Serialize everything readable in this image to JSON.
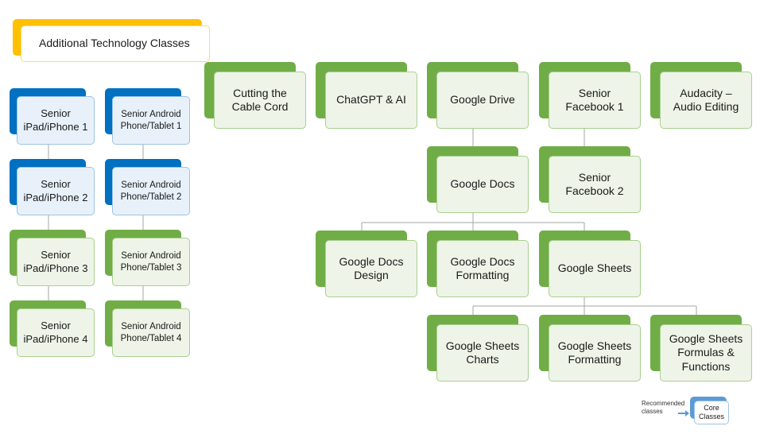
{
  "title": "Additional Technology Classes",
  "colors": {
    "core": "#70ad47",
    "recommended": "#0070c0",
    "title_accent": "#ffc000",
    "connector": "#a6a6a6"
  },
  "nodes": {
    "ipad1": "Senior\niPad/iPhone 1",
    "ipad2": "Senior\niPad/iPhone 2",
    "ipad3": "Senior\niPad/iPhone 3",
    "ipad4": "Senior\niPad/iPhone 4",
    "android1": "Senior Android\nPhone/Tablet 1",
    "android2": "Senior Android\nPhone/Tablet 2",
    "android3": "Senior Android\nPhone/Tablet 3",
    "android4": "Senior Android\nPhone/Tablet 4",
    "cable": "Cutting the\nCable Cord",
    "chatgpt": "ChatGPT & AI",
    "drive": "Google Drive",
    "facebook1": "Senior\nFacebook 1",
    "audacity": "Audacity –\nAudio Editing",
    "docs": "Google Docs",
    "facebook2": "Senior\nFacebook 2",
    "docs_design": "Google Docs\nDesign",
    "docs_formatting": "Google Docs\nFormatting",
    "sheets": "Google Sheets",
    "sheets_charts": "Google Sheets\nCharts",
    "sheets_formatting": "Google Sheets\nFormatting",
    "sheets_formulas": "Google Sheets\nFormulas &\nFunctions"
  },
  "legend": {
    "recommended_label": "Recommended\nclasses",
    "core_label": "Core\nClasses"
  }
}
